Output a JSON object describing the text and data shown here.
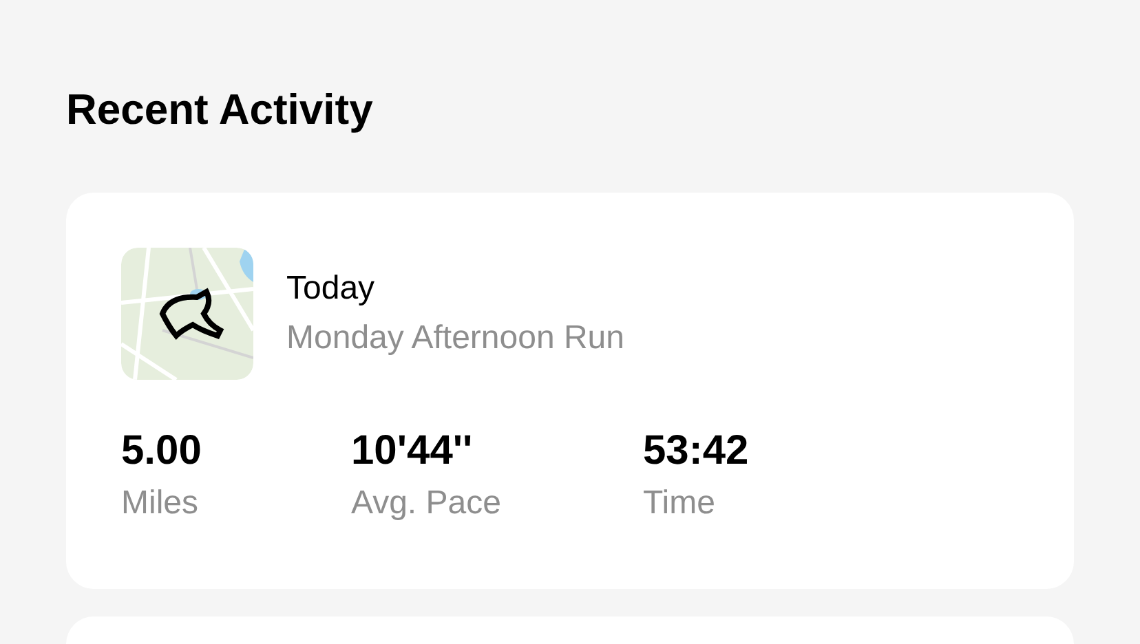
{
  "section_title": "Recent Activity",
  "activities": [
    {
      "date": "Today",
      "name": "Monday Afternoon Run",
      "stats": [
        {
          "value": "5.00",
          "label": "Miles"
        },
        {
          "value": "10'44''",
          "label": "Avg. Pace"
        },
        {
          "value": "53:42",
          "label": "Time"
        }
      ]
    }
  ]
}
